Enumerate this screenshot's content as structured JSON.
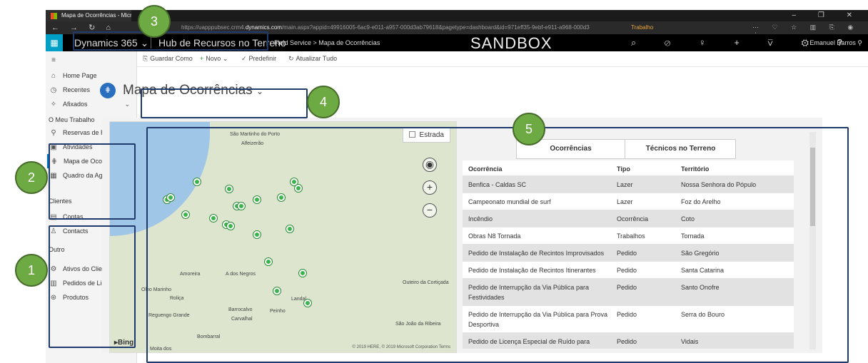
{
  "browser": {
    "tab_title": "Mapa de Ocorrências - Micro",
    "url_prefix": "https://uapppubsec.crm4.",
    "url_domain": "dynamics.com",
    "url_rest": "/main.aspx?appid=49916005-6ac9-e011-a957-000d3ab79618&pagetype=dashboard&id=971eff35-9ebf-e911-a968-000d3",
    "ext_label": "Trabalho",
    "win_controls": "–  ❐  ✕"
  },
  "appbar": {
    "product": "Dynamics 365",
    "hub": "Hub de Recursos no Terreno",
    "breadcrumb": "Field Service  >  Mapa de Ocorrências",
    "environment": "SANDBOX",
    "user": "Emanuel Barros"
  },
  "sidebar": {
    "top": [
      {
        "label": "Home Page",
        "icon": "home-icon"
      },
      {
        "label": "Recentes",
        "icon": "clock-icon"
      },
      {
        "label": "Afixados",
        "icon": "pin-icon"
      }
    ],
    "groups": [
      {
        "title": "O Meu Trabalho",
        "items": [
          {
            "label": "Reservas de Recursos",
            "icon": "resource-icon"
          },
          {
            "label": "Atividades",
            "icon": "activity-icon"
          },
          {
            "label": "Mapa de Ocorrências",
            "icon": "map-icon",
            "active": true
          },
          {
            "label": "Quadro da Agenda",
            "icon": "calendar-icon"
          }
        ]
      },
      {
        "title": "Clientes",
        "items": [
          {
            "label": "Contas",
            "icon": "account-icon"
          },
          {
            "label": "Contacts",
            "icon": "contact-icon"
          }
        ]
      },
      {
        "title": "Outro",
        "items": [
          {
            "label": "Ativos do Cliente",
            "icon": "asset-icon"
          },
          {
            "label": "Pedidos de Licença",
            "icon": "license-icon"
          },
          {
            "label": "Produtos",
            "icon": "product-icon"
          }
        ]
      }
    ]
  },
  "commandbar": {
    "save_as": "Guardar Como",
    "new": "Novo",
    "set_default": "Predefinir",
    "refresh": "Atualizar Tudo"
  },
  "dashboard": {
    "title": "Mapa de Ocorrências"
  },
  "map": {
    "layer_label": "Estrada",
    "attribution": "© 2019 HERE, © 2019 Microsoft Corporation  Terms",
    "provider": "Bing",
    "towns": [
      "São Martinho do Porto",
      "Alfeizerão",
      "Amoreira",
      "A dos Negros",
      "Olho Marinho",
      "Roliça",
      "Bombarral",
      "Reguengo Grande",
      "Barrocalvo",
      "Carvalhal",
      "Peinho",
      "Landal",
      "Outeiro da Cortiçada",
      "São João da Ribeira",
      "Moita dos"
    ]
  },
  "table": {
    "tabs": [
      "Ocorrências",
      "Técnicos no Terreno"
    ],
    "headers": [
      "Ocorrência",
      "Tipo",
      "Território"
    ],
    "rows": [
      [
        "Benfica - Caldas SC",
        "Lazer",
        "Nossa Senhora do Pópulo"
      ],
      [
        "Campeonato mundial de surf",
        "Lazer",
        "Foz do Arelho"
      ],
      [
        "Incêndio",
        "Ocorrência",
        "Coto"
      ],
      [
        "Obras N8 Tornada",
        "Trabalhos",
        "Tornada"
      ],
      [
        "Pedido de Instalação de Recintos Improvisados",
        "Pedido",
        "São Gregório"
      ],
      [
        "Pedido de Instalação de Recintos Itinerantes",
        "Pedido",
        "Santa Catarina"
      ],
      [
        "Pedido de Interrupção da Via Pública para Festividades",
        "Pedido",
        "Santo Onofre"
      ],
      [
        "Pedido de Interrupção da Via Pública para Prova Desportiva",
        "Pedido",
        "Serra do Bouro"
      ],
      [
        "Pedido de Licença Especial de Ruído para",
        "Pedido",
        "Vidais"
      ]
    ]
  },
  "callouts": [
    "1",
    "2",
    "3",
    "4",
    "5"
  ]
}
